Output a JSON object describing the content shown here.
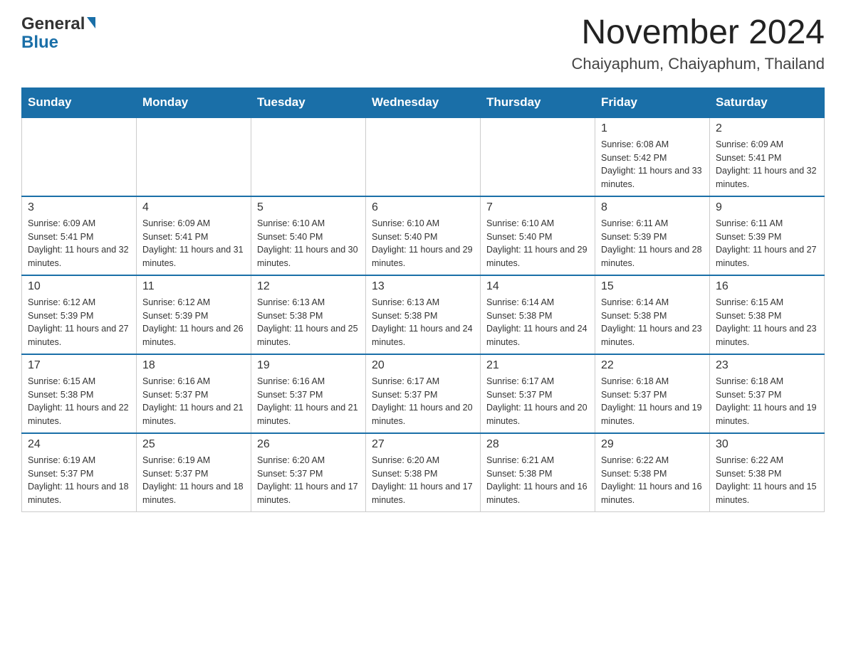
{
  "header": {
    "logo_general": "General",
    "logo_blue": "Blue",
    "month_title": "November 2024",
    "location": "Chaiyaphum, Chaiyaphum, Thailand"
  },
  "calendar": {
    "days_of_week": [
      "Sunday",
      "Monday",
      "Tuesday",
      "Wednesday",
      "Thursday",
      "Friday",
      "Saturday"
    ],
    "weeks": [
      [
        {
          "day": "",
          "info": "",
          "empty": true
        },
        {
          "day": "",
          "info": "",
          "empty": true
        },
        {
          "day": "",
          "info": "",
          "empty": true
        },
        {
          "day": "",
          "info": "",
          "empty": true
        },
        {
          "day": "",
          "info": "",
          "empty": true
        },
        {
          "day": "1",
          "info": "Sunrise: 6:08 AM\nSunset: 5:42 PM\nDaylight: 11 hours and 33 minutes."
        },
        {
          "day": "2",
          "info": "Sunrise: 6:09 AM\nSunset: 5:41 PM\nDaylight: 11 hours and 32 minutes."
        }
      ],
      [
        {
          "day": "3",
          "info": "Sunrise: 6:09 AM\nSunset: 5:41 PM\nDaylight: 11 hours and 32 minutes."
        },
        {
          "day": "4",
          "info": "Sunrise: 6:09 AM\nSunset: 5:41 PM\nDaylight: 11 hours and 31 minutes."
        },
        {
          "day": "5",
          "info": "Sunrise: 6:10 AM\nSunset: 5:40 PM\nDaylight: 11 hours and 30 minutes."
        },
        {
          "day": "6",
          "info": "Sunrise: 6:10 AM\nSunset: 5:40 PM\nDaylight: 11 hours and 29 minutes."
        },
        {
          "day": "7",
          "info": "Sunrise: 6:10 AM\nSunset: 5:40 PM\nDaylight: 11 hours and 29 minutes."
        },
        {
          "day": "8",
          "info": "Sunrise: 6:11 AM\nSunset: 5:39 PM\nDaylight: 11 hours and 28 minutes."
        },
        {
          "day": "9",
          "info": "Sunrise: 6:11 AM\nSunset: 5:39 PM\nDaylight: 11 hours and 27 minutes."
        }
      ],
      [
        {
          "day": "10",
          "info": "Sunrise: 6:12 AM\nSunset: 5:39 PM\nDaylight: 11 hours and 27 minutes."
        },
        {
          "day": "11",
          "info": "Sunrise: 6:12 AM\nSunset: 5:39 PM\nDaylight: 11 hours and 26 minutes."
        },
        {
          "day": "12",
          "info": "Sunrise: 6:13 AM\nSunset: 5:38 PM\nDaylight: 11 hours and 25 minutes."
        },
        {
          "day": "13",
          "info": "Sunrise: 6:13 AM\nSunset: 5:38 PM\nDaylight: 11 hours and 24 minutes."
        },
        {
          "day": "14",
          "info": "Sunrise: 6:14 AM\nSunset: 5:38 PM\nDaylight: 11 hours and 24 minutes."
        },
        {
          "day": "15",
          "info": "Sunrise: 6:14 AM\nSunset: 5:38 PM\nDaylight: 11 hours and 23 minutes."
        },
        {
          "day": "16",
          "info": "Sunrise: 6:15 AM\nSunset: 5:38 PM\nDaylight: 11 hours and 23 minutes."
        }
      ],
      [
        {
          "day": "17",
          "info": "Sunrise: 6:15 AM\nSunset: 5:38 PM\nDaylight: 11 hours and 22 minutes."
        },
        {
          "day": "18",
          "info": "Sunrise: 6:16 AM\nSunset: 5:37 PM\nDaylight: 11 hours and 21 minutes."
        },
        {
          "day": "19",
          "info": "Sunrise: 6:16 AM\nSunset: 5:37 PM\nDaylight: 11 hours and 21 minutes."
        },
        {
          "day": "20",
          "info": "Sunrise: 6:17 AM\nSunset: 5:37 PM\nDaylight: 11 hours and 20 minutes."
        },
        {
          "day": "21",
          "info": "Sunrise: 6:17 AM\nSunset: 5:37 PM\nDaylight: 11 hours and 20 minutes."
        },
        {
          "day": "22",
          "info": "Sunrise: 6:18 AM\nSunset: 5:37 PM\nDaylight: 11 hours and 19 minutes."
        },
        {
          "day": "23",
          "info": "Sunrise: 6:18 AM\nSunset: 5:37 PM\nDaylight: 11 hours and 19 minutes."
        }
      ],
      [
        {
          "day": "24",
          "info": "Sunrise: 6:19 AM\nSunset: 5:37 PM\nDaylight: 11 hours and 18 minutes."
        },
        {
          "day": "25",
          "info": "Sunrise: 6:19 AM\nSunset: 5:37 PM\nDaylight: 11 hours and 18 minutes."
        },
        {
          "day": "26",
          "info": "Sunrise: 6:20 AM\nSunset: 5:37 PM\nDaylight: 11 hours and 17 minutes."
        },
        {
          "day": "27",
          "info": "Sunrise: 6:20 AM\nSunset: 5:38 PM\nDaylight: 11 hours and 17 minutes."
        },
        {
          "day": "28",
          "info": "Sunrise: 6:21 AM\nSunset: 5:38 PM\nDaylight: 11 hours and 16 minutes."
        },
        {
          "day": "29",
          "info": "Sunrise: 6:22 AM\nSunset: 5:38 PM\nDaylight: 11 hours and 16 minutes."
        },
        {
          "day": "30",
          "info": "Sunrise: 6:22 AM\nSunset: 5:38 PM\nDaylight: 11 hours and 15 minutes."
        }
      ]
    ]
  }
}
